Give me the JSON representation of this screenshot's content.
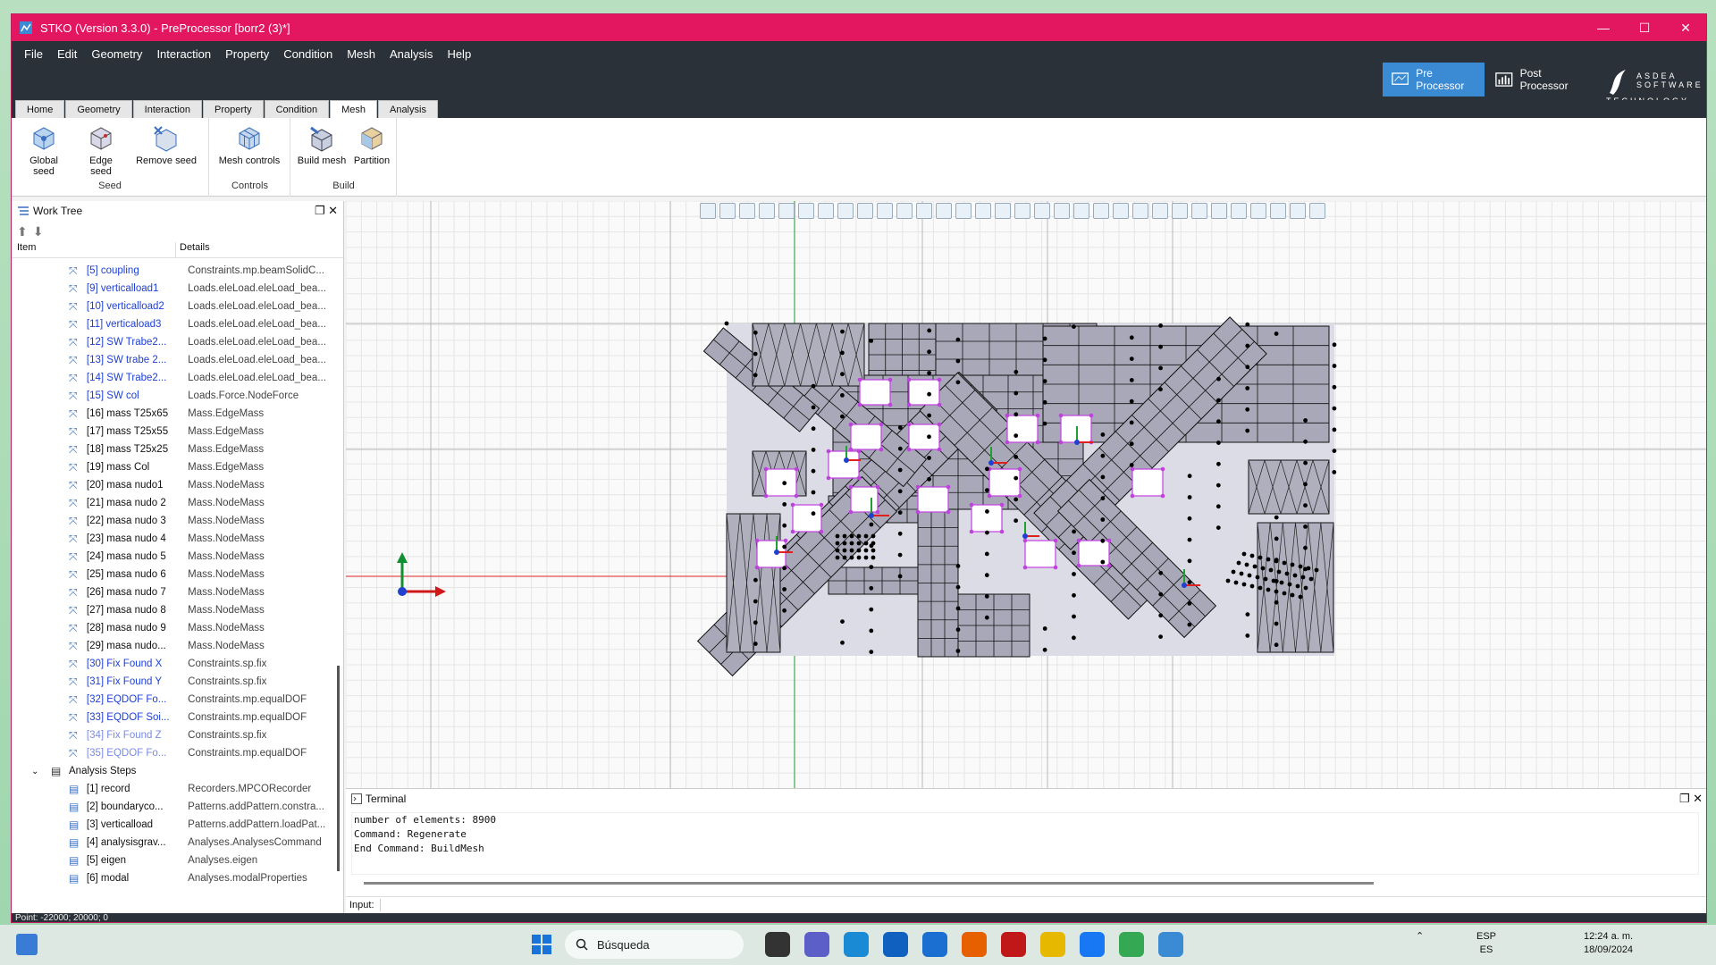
{
  "window": {
    "title": "STKO (Version 3.3.0) - PreProcessor [borr2 (3)*]"
  },
  "menu": [
    "File",
    "Edit",
    "Geometry",
    "Interaction",
    "Property",
    "Condition",
    "Mesh",
    "Analysis",
    "Help"
  ],
  "modes": {
    "pre": "Pre Processor",
    "post": "Post Processor",
    "logo": "ASDEA SOFTWARE TECHNOLOGY"
  },
  "tabs": [
    "Home",
    "Geometry",
    "Interaction",
    "Property",
    "Condition",
    "Mesh",
    "Analysis"
  ],
  "active_tab": "Mesh",
  "ribbon": {
    "seed": {
      "label": "Seed",
      "buttons": [
        "Global seed",
        "Edge seed",
        "Remove seed"
      ]
    },
    "controls": {
      "label": "Controls",
      "buttons": [
        "Mesh controls"
      ]
    },
    "build": {
      "label": "Build",
      "buttons": [
        "Build mesh",
        "Partition"
      ]
    }
  },
  "worktree": {
    "title": "Work Tree",
    "col_item": "Item",
    "col_details": "Details",
    "rows": [
      {
        "name": "[5] coupling",
        "details": "Constraints.mp.beamSolidC...",
        "style": "blue"
      },
      {
        "name": "[9] verticalload1",
        "details": "Loads.eleLoad.eleLoad_bea...",
        "style": "blue"
      },
      {
        "name": "[10] verticalload2",
        "details": "Loads.eleLoad.eleLoad_bea...",
        "style": "blue"
      },
      {
        "name": "[11] verticaload3",
        "details": "Loads.eleLoad.eleLoad_bea...",
        "style": "blue"
      },
      {
        "name": "[12] SW Trabe2...",
        "details": "Loads.eleLoad.eleLoad_bea...",
        "style": "blue"
      },
      {
        "name": "[13] SW trabe 2...",
        "details": "Loads.eleLoad.eleLoad_bea...",
        "style": "blue"
      },
      {
        "name": "[14] SW Trabe2...",
        "details": "Loads.eleLoad.eleLoad_bea...",
        "style": "blue"
      },
      {
        "name": "[15] SW col",
        "details": "Loads.Force.NodeForce",
        "style": "blue"
      },
      {
        "name": "[16] mass T25x65",
        "details": "Mass.EdgeMass",
        "style": "black"
      },
      {
        "name": "[17] mass T25x55",
        "details": "Mass.EdgeMass",
        "style": "black"
      },
      {
        "name": "[18] mass T25x25",
        "details": "Mass.EdgeMass",
        "style": "black"
      },
      {
        "name": "[19] mass Col",
        "details": "Mass.EdgeMass",
        "style": "black"
      },
      {
        "name": "[20] masa nudo1",
        "details": "Mass.NodeMass",
        "style": "black"
      },
      {
        "name": "[21] masa nudo 2",
        "details": "Mass.NodeMass",
        "style": "black"
      },
      {
        "name": "[22] masa nudo 3",
        "details": "Mass.NodeMass",
        "style": "black"
      },
      {
        "name": "[23] masa nudo 4",
        "details": "Mass.NodeMass",
        "style": "black"
      },
      {
        "name": "[24] masa nudo 5",
        "details": "Mass.NodeMass",
        "style": "black"
      },
      {
        "name": "[25] masa nudo 6",
        "details": "Mass.NodeMass",
        "style": "black"
      },
      {
        "name": "[26] masa nudo 7",
        "details": "Mass.NodeMass",
        "style": "black"
      },
      {
        "name": "[27] masa nudo 8",
        "details": "Mass.NodeMass",
        "style": "black"
      },
      {
        "name": "[28] masa nudo 9",
        "details": "Mass.NodeMass",
        "style": "black"
      },
      {
        "name": "[29] masa nudo...",
        "details": "Mass.NodeMass",
        "style": "black"
      },
      {
        "name": "[30] Fix Found X",
        "details": "Constraints.sp.fix",
        "style": "blue"
      },
      {
        "name": "[31] Fix Found Y",
        "details": "Constraints.sp.fix",
        "style": "blue"
      },
      {
        "name": "[32] EQDOF Fo...",
        "details": "Constraints.mp.equalDOF",
        "style": "blue"
      },
      {
        "name": "[33] EQDOF Soi...",
        "details": "Constraints.mp.equalDOF",
        "style": "blue"
      },
      {
        "name": "[34] Fix Found Z",
        "details": "Constraints.sp.fix",
        "style": "faded"
      },
      {
        "name": "[35] EQDOF Fo...",
        "details": "Constraints.mp.equalDOF",
        "style": "faded"
      }
    ],
    "group": "Analysis Steps",
    "steps": [
      {
        "name": "[1] record",
        "details": "Recorders.MPCORecorder"
      },
      {
        "name": "[2] boundaryco...",
        "details": "Patterns.addPattern.constra..."
      },
      {
        "name": "[3] verticalload",
        "details": "Patterns.addPattern.loadPat..."
      },
      {
        "name": "[4] analysisgrav...",
        "details": "Analyses.AnalysesCommand"
      },
      {
        "name": "[5] eigen",
        "details": "Analyses.eigen"
      },
      {
        "name": "[6] modal",
        "details": "Analyses.modalProperties"
      }
    ]
  },
  "terminal": {
    "title": "Terminal",
    "lines": [
      "number of elements: 8900",
      "Command: Regenerate",
      "End Command: BuildMesh"
    ],
    "input_label": "Input:"
  },
  "status": {
    "point": "Point: -22000; 20000; 0"
  },
  "taskbar": {
    "search": "Búsqueda",
    "lang1": "ESP",
    "lang2": "ES",
    "time": "12:24 a. m.",
    "date": "18/09/2024"
  },
  "colors": {
    "titlebar": "#e3175f",
    "menubar": "#2b3138",
    "mode_active": "#3a8ad4",
    "mesh_fill": "#a9a8b8",
    "highlight": "#c040e0",
    "axis_x": "#e02020",
    "axis_y": "#20a030"
  }
}
